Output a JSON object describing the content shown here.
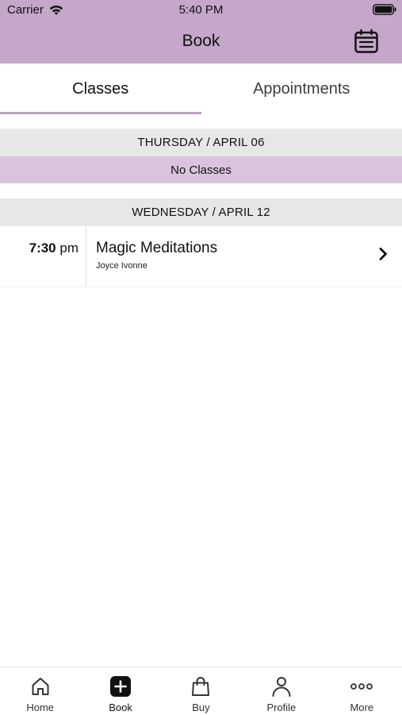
{
  "status_bar": {
    "carrier": "Carrier",
    "time": "5:40 PM"
  },
  "header": {
    "title": "Book",
    "background_color": "#c4a7c9"
  },
  "tabs": [
    {
      "label": "Classes",
      "active": true
    },
    {
      "label": "Appointments",
      "active": false
    }
  ],
  "schedule": [
    {
      "day_label": "THURSDAY / APRIL 06",
      "empty_text": "No Classes"
    },
    {
      "day_label": "WEDNESDAY / APRIL 12",
      "classes": [
        {
          "time_hour": "7:30",
          "time_period": "pm",
          "name": "Magic Meditations",
          "instructor": "Joyce Ivonne"
        }
      ]
    }
  ],
  "bottom_nav": [
    {
      "label": "Home",
      "icon": "home-icon"
    },
    {
      "label": "Book",
      "icon": "plus-icon",
      "active": true
    },
    {
      "label": "Buy",
      "icon": "shopping-bag-icon"
    },
    {
      "label": "Profile",
      "icon": "person-icon"
    },
    {
      "label": "More",
      "icon": "more-icon"
    }
  ],
  "colors": {
    "accent": "#c4a7c9",
    "no_classes_bg": "#dac4dd",
    "day_header_bg": "#e7e7e7"
  }
}
